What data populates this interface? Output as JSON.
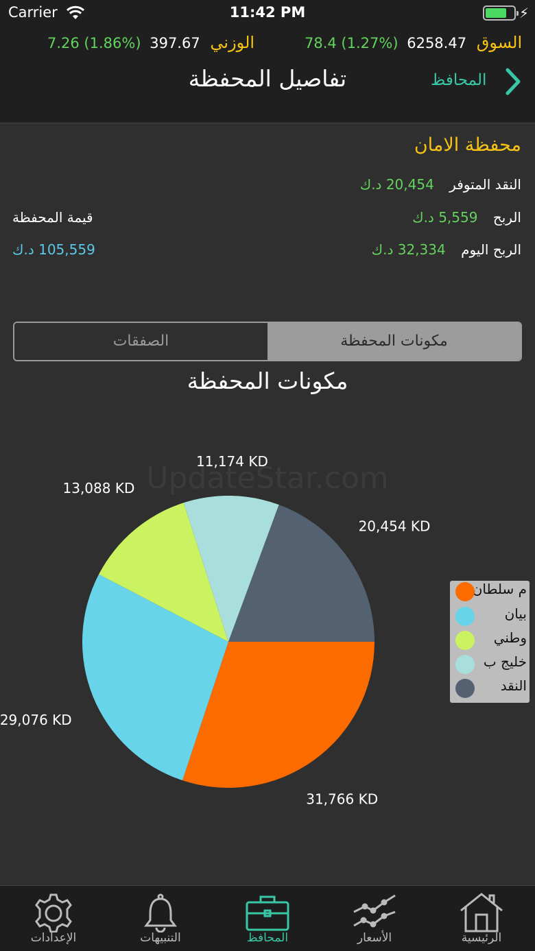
{
  "status_bar": {
    "carrier": "Carrier",
    "time": "11:42 PM"
  },
  "tickers": [
    {
      "name": "السوق",
      "value": "6258.47",
      "change": "78.4 (1.27%)"
    },
    {
      "name": "الوزني",
      "value": "397.67",
      "change": "7.26 (1.86%)"
    }
  ],
  "nav": {
    "title": "تفاصيل المحفظة",
    "back_label": "المحافظ"
  },
  "portfolio": {
    "name": "محفظة الامان",
    "cash_label": "النقد المتوفر",
    "cash_value": "20,454 د.ك",
    "profit_label": "الربح",
    "profit_value": "5,559 د.ك",
    "today_profit_label": "الربح اليوم",
    "today_profit_value": "32,334 د.ك",
    "value_label": "قيمة المحفظة",
    "value_value": "105,559 د.ك"
  },
  "segments": {
    "components": "مكونات المحفظة",
    "deals": "الصفقات",
    "selected": "components"
  },
  "watermark": "UpdateStar.com",
  "chart_data": {
    "type": "pie",
    "title": "مكونات المحفظة",
    "slices": [
      {
        "name": "م سلطان",
        "value": 31766,
        "label": "31,766 KD",
        "color": "#fb6b00"
      },
      {
        "name": "بيان",
        "value": 29076,
        "label": "29,076 KD",
        "color": "#67d4ea"
      },
      {
        "name": "وطني",
        "value": 13088,
        "label": "13,088 KD",
        "color": "#cbf261"
      },
      {
        "name": "خليج ب",
        "value": 11174,
        "label": "11,174 KD",
        "color": "#a8dedb"
      },
      {
        "name": "النقد",
        "value": 20454,
        "label": "20,454 KD",
        "color": "#536170"
      }
    ],
    "legend_position": "right"
  },
  "tabs": [
    {
      "label": "الإعدادات",
      "icon": "gear-icon"
    },
    {
      "label": "التنبيهات",
      "icon": "bell-icon"
    },
    {
      "label": "المحافظ",
      "icon": "briefcase-icon",
      "active": true
    },
    {
      "label": "الأسعار",
      "icon": "chart-line-icon"
    },
    {
      "label": "الرئيسية",
      "icon": "home-icon"
    }
  ],
  "colors": {
    "accent": "#39c8a6",
    "gold": "#f6c315",
    "green": "#63d35e",
    "blue": "#5bc8e8"
  }
}
